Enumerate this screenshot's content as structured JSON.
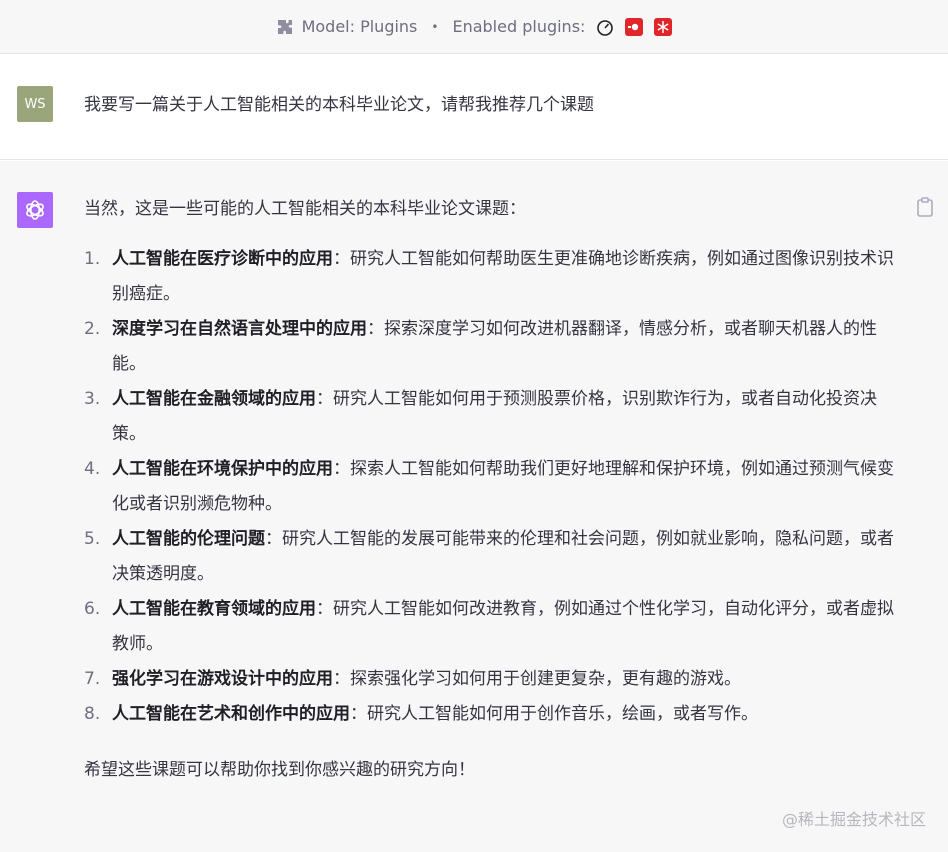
{
  "header": {
    "model_label": "Model: Plugins",
    "separator": "•",
    "enabled_label": "Enabled plugins:",
    "plugin_icons": [
      "speedometer-icon",
      "red-record-icon",
      "red-snowflake-icon"
    ]
  },
  "user": {
    "avatar_initials": "WS",
    "message": "我要写一篇关于人工智能相关的本科毕业论文，请帮我推荐几个课题"
  },
  "assistant": {
    "intro": "当然，这是一些可能的人工智能相关的本科毕业论文课题：",
    "items": [
      {
        "num": "1.",
        "title": "人工智能在医疗诊断中的应用",
        "desc": "：研究人工智能如何帮助医生更准确地诊断疾病，例如通过图像识别技术识别癌症。"
      },
      {
        "num": "2.",
        "title": "深度学习在自然语言处理中的应用",
        "desc": "：探索深度学习如何改进机器翻译，情感分析，或者聊天机器人的性能。"
      },
      {
        "num": "3.",
        "title": "人工智能在金融领域的应用",
        "desc": "：研究人工智能如何用于预测股票价格，识别欺诈行为，或者自动化投资决策。"
      },
      {
        "num": "4.",
        "title": "人工智能在环境保护中的应用",
        "desc": "：探索人工智能如何帮助我们更好地理解和保护环境，例如通过预测气候变化或者识别濒危物种。"
      },
      {
        "num": "5.",
        "title": "人工智能的伦理问题",
        "desc": "：研究人工智能的发展可能带来的伦理和社会问题，例如就业影响，隐私问题，或者决策透明度。"
      },
      {
        "num": "6.",
        "title": "人工智能在教育领域的应用",
        "desc": "：研究人工智能如何改进教育，例如通过个性化学习，自动化评分，或者虚拟教师。"
      },
      {
        "num": "7.",
        "title": "强化学习在游戏设计中的应用",
        "desc": "：探索强化学习如何用于创建更复杂，更有趣的游戏。"
      },
      {
        "num": "8.",
        "title": "人工智能在艺术和创作中的应用",
        "desc": "：研究人工智能如何用于创作音乐，绘画，或者写作。"
      }
    ],
    "outro": "希望这些课题可以帮助你找到你感兴趣的研究方向！"
  },
  "watermark": "@稀土掘金技术社区",
  "colors": {
    "gpt_avatar": "#ab68ff",
    "user_avatar": "#9aa57b",
    "plugin_red": "#e0252b"
  }
}
